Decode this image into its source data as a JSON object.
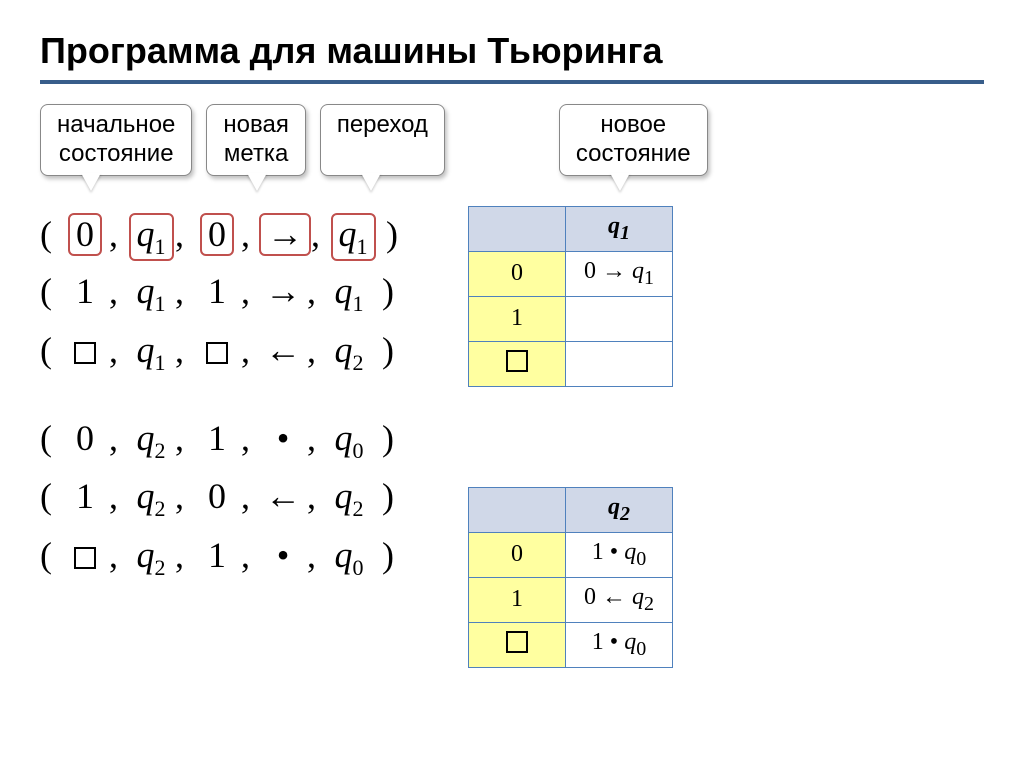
{
  "title": "Программа для машины Тьюринга",
  "labels": {
    "initial_state": "начальное\nсостояние",
    "new_mark": "новая\nметка",
    "transition": "переход",
    "new_state": "новое\nсостояние"
  },
  "tuples_group1": [
    {
      "sym": "0",
      "state": "q1",
      "newsym": "0",
      "move": "→",
      "newstate": "q1",
      "highlight": true
    },
    {
      "sym": "1",
      "state": "q1",
      "newsym": "1",
      "move": "→",
      "newstate": "q1",
      "highlight": false
    },
    {
      "sym": "□",
      "state": "q1",
      "newsym": "□",
      "move": "←",
      "newstate": "q2",
      "highlight": false
    }
  ],
  "tuples_group2": [
    {
      "sym": "0",
      "state": "q2",
      "newsym": "1",
      "move": "•",
      "newstate": "q0",
      "highlight": false
    },
    {
      "sym": "1",
      "state": "q2",
      "newsym": "0",
      "move": "←",
      "newstate": "q2",
      "highlight": false
    },
    {
      "sym": "□",
      "state": "q2",
      "newsym": "1",
      "move": "•",
      "newstate": "q0",
      "highlight": false
    }
  ],
  "table1": {
    "state": "q1",
    "rows": [
      {
        "sym": "0",
        "val": "0 → q1"
      },
      {
        "sym": "1",
        "val": ""
      },
      {
        "sym": "□",
        "val": ""
      }
    ]
  },
  "table2": {
    "state": "q2",
    "rows": [
      {
        "sym": "0",
        "val": "1 • q0"
      },
      {
        "sym": "1",
        "val": "0 ← q2"
      },
      {
        "sym": "□",
        "val": "1 • q0"
      }
    ]
  }
}
